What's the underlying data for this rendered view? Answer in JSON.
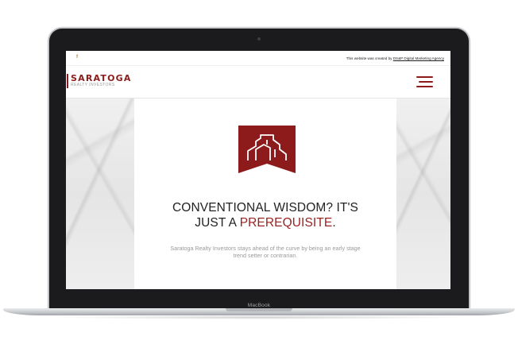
{
  "device": {
    "brand_label": "MacBook"
  },
  "topbar": {
    "facebook_glyph": "f",
    "credit_prefix": "This website was created by ",
    "credit_link": "DS&P Digital Marketing Agency"
  },
  "header": {
    "logo_name": "SARATOGA",
    "logo_subtitle": "REALTY INVESTORS"
  },
  "hero": {
    "headline_line1": "CONVENTIONAL WISDOM? IT'S",
    "headline_line2_prefix": "JUST A ",
    "headline_accent": "PREREQUISITE",
    "headline_suffix": ".",
    "tagline": "Saratoga Realty Investors stays ahead of the curve by being an early stage trend setter or contrarian."
  },
  "colors": {
    "brand_red": "#8e1b1b",
    "accent_red": "#9a1f1f",
    "chassis": "#1b1b1d"
  },
  "icons": {
    "menu": "hamburger-menu-icon",
    "emblem": "building-emblem-icon",
    "social": "facebook-icon"
  }
}
